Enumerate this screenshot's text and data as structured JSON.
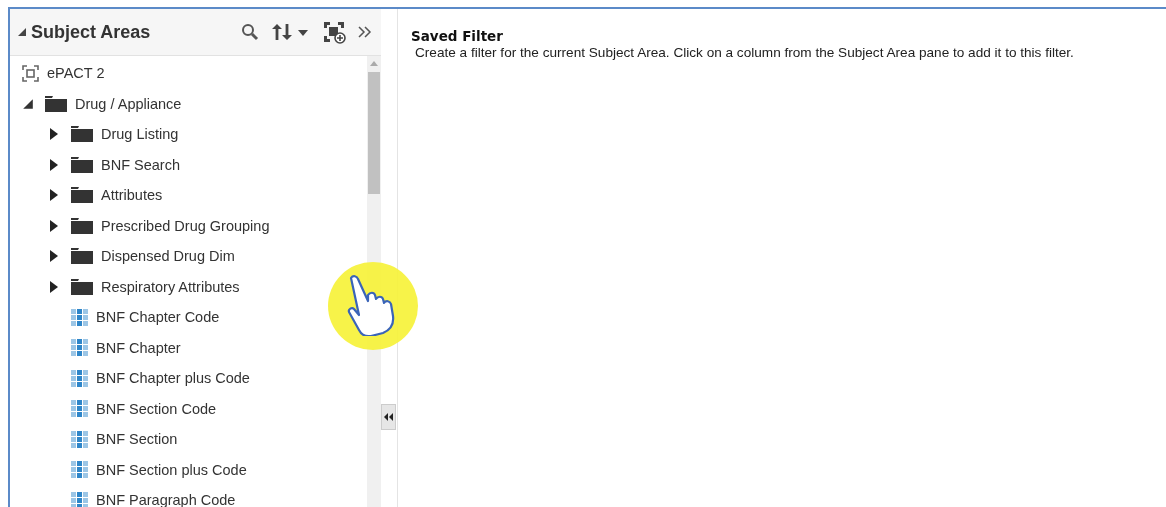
{
  "subject_areas": {
    "title": "Subject Areas",
    "expanded": true,
    "tree": [
      {
        "label": "ePACT 2",
        "kind": "subject"
      },
      {
        "label": "Drug / Appliance",
        "kind": "folder",
        "expanded": true,
        "children": [
          {
            "label": "Drug Listing",
            "kind": "folder",
            "expanded": false
          },
          {
            "label": "BNF Search",
            "kind": "folder",
            "expanded": false
          },
          {
            "label": "Attributes",
            "kind": "folder",
            "expanded": false
          },
          {
            "label": "Prescribed Drug Grouping",
            "kind": "folder",
            "expanded": false
          },
          {
            "label": "Dispensed Drug Dim",
            "kind": "folder",
            "expanded": false
          },
          {
            "label": "Respiratory Attributes",
            "kind": "folder",
            "expanded": false
          },
          {
            "label": "BNF Chapter Code",
            "kind": "column"
          },
          {
            "label": "BNF Chapter",
            "kind": "column"
          },
          {
            "label": "BNF Chapter plus Code",
            "kind": "column"
          },
          {
            "label": "BNF Section Code",
            "kind": "column"
          },
          {
            "label": "BNF Section",
            "kind": "column"
          },
          {
            "label": "BNF Section plus Code",
            "kind": "column"
          },
          {
            "label": "BNF Paragraph Code",
            "kind": "column"
          }
        ]
      }
    ]
  },
  "saved_filter": {
    "title": "Saved Filter",
    "description": "Create a filter for the current Subject Area. Click on a column from the Subject Area pane to add it to this filter."
  }
}
